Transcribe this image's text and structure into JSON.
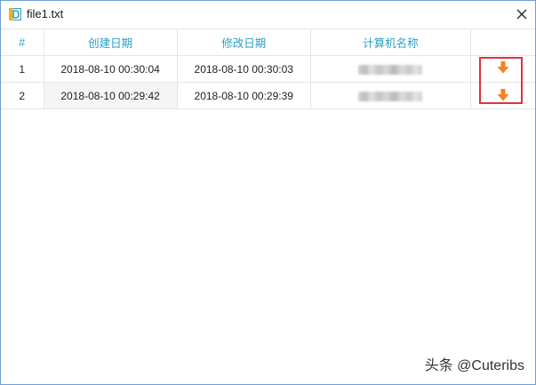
{
  "window": {
    "title": "file1.txt",
    "close_icon": "close-icon",
    "app_icon": "document-d-icon"
  },
  "table": {
    "headers": {
      "index": "#",
      "created": "创建日期",
      "modified": "修改日期",
      "computer": "计算机名称"
    },
    "rows": [
      {
        "index": "1",
        "created": "2018-08-10 00:30:04",
        "modified": "2018-08-10 00:30:03",
        "computer_blurred": true,
        "action_icon": "download-arrow-icon"
      },
      {
        "index": "2",
        "created": "2018-08-10 00:29:42",
        "modified": "2018-08-10 00:29:39",
        "computer_blurred": true,
        "action_icon": "download-arrow-icon"
      }
    ]
  },
  "colors": {
    "header_text": "#2aa0c8",
    "action_arrow": "#f58220",
    "highlight_border": "#d9363e"
  },
  "watermark": "头条 @Cuteribs"
}
